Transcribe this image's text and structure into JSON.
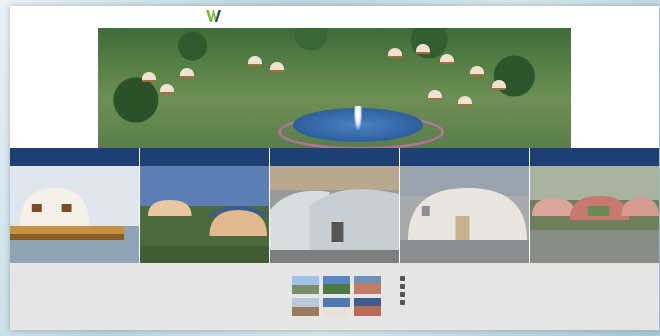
{
  "header": {
    "logo_name": "",
    "logo_sub": "",
    "nav": [
      "",
      "",
      "",
      "",
      "",
      "",
      "",
      ""
    ]
  },
  "hero": {
    "caption_line1": "",
    "caption_line2": ""
  },
  "categories": [
    {
      "label": ""
    },
    {
      "label": ""
    },
    {
      "label": ""
    },
    {
      "label": ""
    },
    {
      "label": ""
    }
  ],
  "footer": {
    "about_title": "",
    "about_text": "",
    "gallery_title": "",
    "contact_title": "",
    "contacts": [
      "",
      "",
      "",
      ""
    ]
  },
  "colors": {
    "nav_bar": "#1e3f73",
    "footer_bg": "#e6e6e6",
    "logo_accent": "#7db53a"
  }
}
